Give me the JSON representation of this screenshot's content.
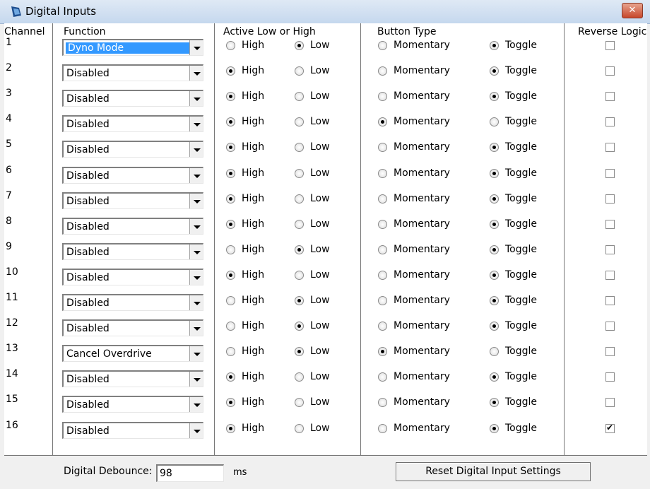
{
  "window": {
    "title": "Digital Inputs",
    "close_label": "✕"
  },
  "headers": {
    "channel": "Channel",
    "function": "Function",
    "active": "Active Low or High",
    "button_type": "Button Type",
    "reverse": "Reverse Logic"
  },
  "labels": {
    "high": "High",
    "low": "Low",
    "momentary": "Momentary",
    "toggle": "Toggle"
  },
  "rows": [
    {
      "channel": "1",
      "function": "Dyno Mode",
      "active": "Low",
      "button": "Toggle",
      "reverse": false
    },
    {
      "channel": "2",
      "function": "Disabled",
      "active": "High",
      "button": "Toggle",
      "reverse": false
    },
    {
      "channel": "3",
      "function": "Disabled",
      "active": "High",
      "button": "Toggle",
      "reverse": false
    },
    {
      "channel": "4",
      "function": "Disabled",
      "active": "High",
      "button": "Momentary",
      "reverse": false
    },
    {
      "channel": "5",
      "function": "Disabled",
      "active": "High",
      "button": "Toggle",
      "reverse": false
    },
    {
      "channel": "6",
      "function": "Disabled",
      "active": "High",
      "button": "Toggle",
      "reverse": false
    },
    {
      "channel": "7",
      "function": "Disabled",
      "active": "High",
      "button": "Toggle",
      "reverse": false
    },
    {
      "channel": "8",
      "function": "Disabled",
      "active": "High",
      "button": "Toggle",
      "reverse": false
    },
    {
      "channel": "9",
      "function": "Disabled",
      "active": "Low",
      "button": "Toggle",
      "reverse": false
    },
    {
      "channel": "10",
      "function": "Disabled",
      "active": "High",
      "button": "Toggle",
      "reverse": false
    },
    {
      "channel": "11",
      "function": "Disabled",
      "active": "Low",
      "button": "Toggle",
      "reverse": false
    },
    {
      "channel": "12",
      "function": "Disabled",
      "active": "Low",
      "button": "Toggle",
      "reverse": false
    },
    {
      "channel": "13",
      "function": "Cancel Overdrive",
      "active": "Low",
      "button": "Momentary",
      "reverse": false
    },
    {
      "channel": "14",
      "function": "Disabled",
      "active": "High",
      "button": "Toggle",
      "reverse": false
    },
    {
      "channel": "15",
      "function": "Disabled",
      "active": "High",
      "button": "Toggle",
      "reverse": false
    },
    {
      "channel": "16",
      "function": "Disabled",
      "active": "High",
      "button": "Toggle",
      "reverse": true
    }
  ],
  "footer": {
    "debounce_label": "Digital Debounce:",
    "debounce_value": "98",
    "debounce_unit": "ms",
    "reset_label": "Reset Digital Input Settings"
  }
}
